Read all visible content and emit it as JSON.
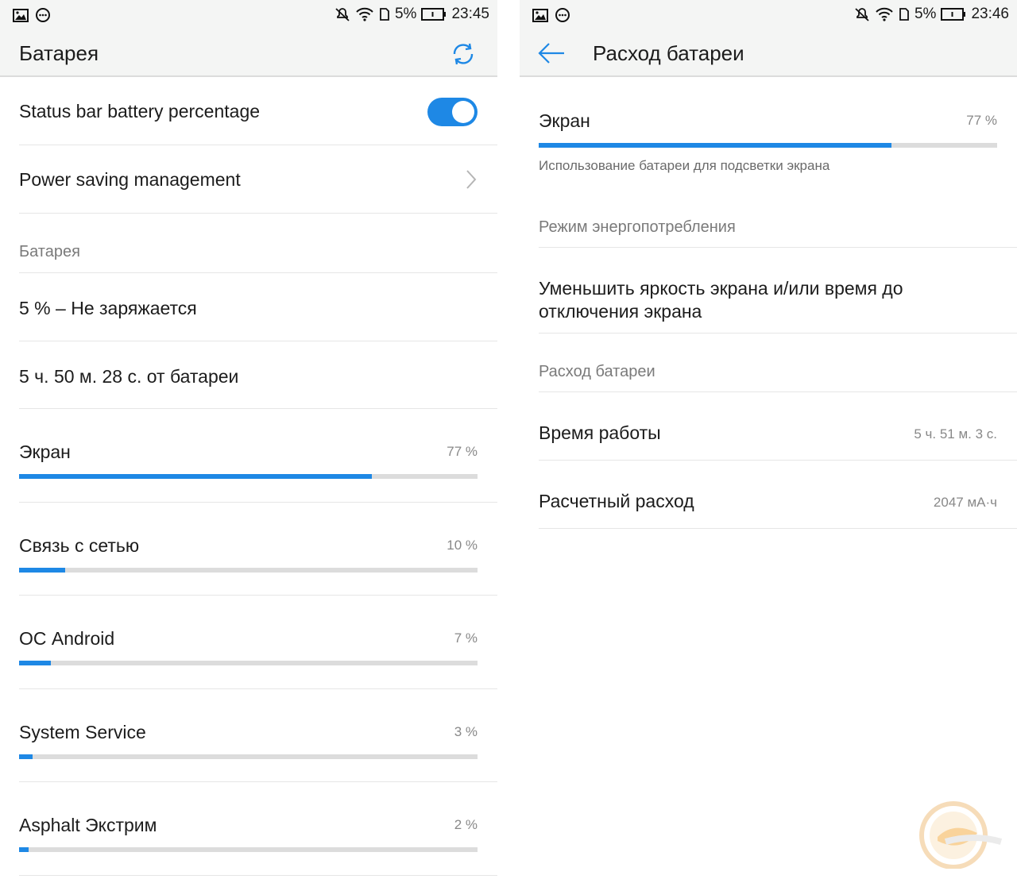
{
  "left": {
    "status": {
      "battery_text": "5%",
      "time": "23:45"
    },
    "appbar": {
      "title": "Батарея"
    },
    "settings": [
      {
        "label": "Status bar battery percentage",
        "toggle_on": true
      },
      {
        "label": "Power saving management"
      }
    ],
    "section_header": "Батарея",
    "info": [
      "5 % – Не заряжается",
      "5 ч. 50 м. 28 с. от батареи"
    ],
    "usage": [
      {
        "name": "Экран",
        "percent_text": "77 %",
        "percent": 77
      },
      {
        "name": "Связь с сетью",
        "percent_text": "10 %",
        "percent": 10
      },
      {
        "name": "ОС Android",
        "percent_text": "7 %",
        "percent": 7
      },
      {
        "name": "System Service",
        "percent_text": "3 %",
        "percent": 3
      },
      {
        "name": "Asphalt Экстрим",
        "percent_text": "2 %",
        "percent": 2
      }
    ]
  },
  "right": {
    "status": {
      "battery_text": "5%",
      "time": "23:46"
    },
    "appbar": {
      "title": "Расход батареи"
    },
    "main": {
      "name": "Экран",
      "percent_text": "77 %",
      "percent": 77,
      "description": "Использование батареи для подсветки экрана"
    },
    "power_mode_header": "Режим энергопотребления",
    "power_mode_tip": "Уменьшить яркость экрана и/или время до отключения экрана",
    "usage_header": "Расход батареи",
    "details": [
      {
        "label": "Время работы",
        "value": "5 ч. 51 м. 3 с."
      },
      {
        "label": "Расчетный расход",
        "value": "2047 мА·ч"
      }
    ]
  },
  "colors": {
    "accent": "#1e88e5",
    "track": "#dcdcdc",
    "appbar_bg": "#f4f5f4"
  },
  "icons": [
    "image-icon",
    "notification-icon",
    "mute-icon",
    "wifi-icon",
    "sim-icon",
    "battery-icon",
    "refresh-icon",
    "chevron-right-icon",
    "back-arrow-icon"
  ]
}
